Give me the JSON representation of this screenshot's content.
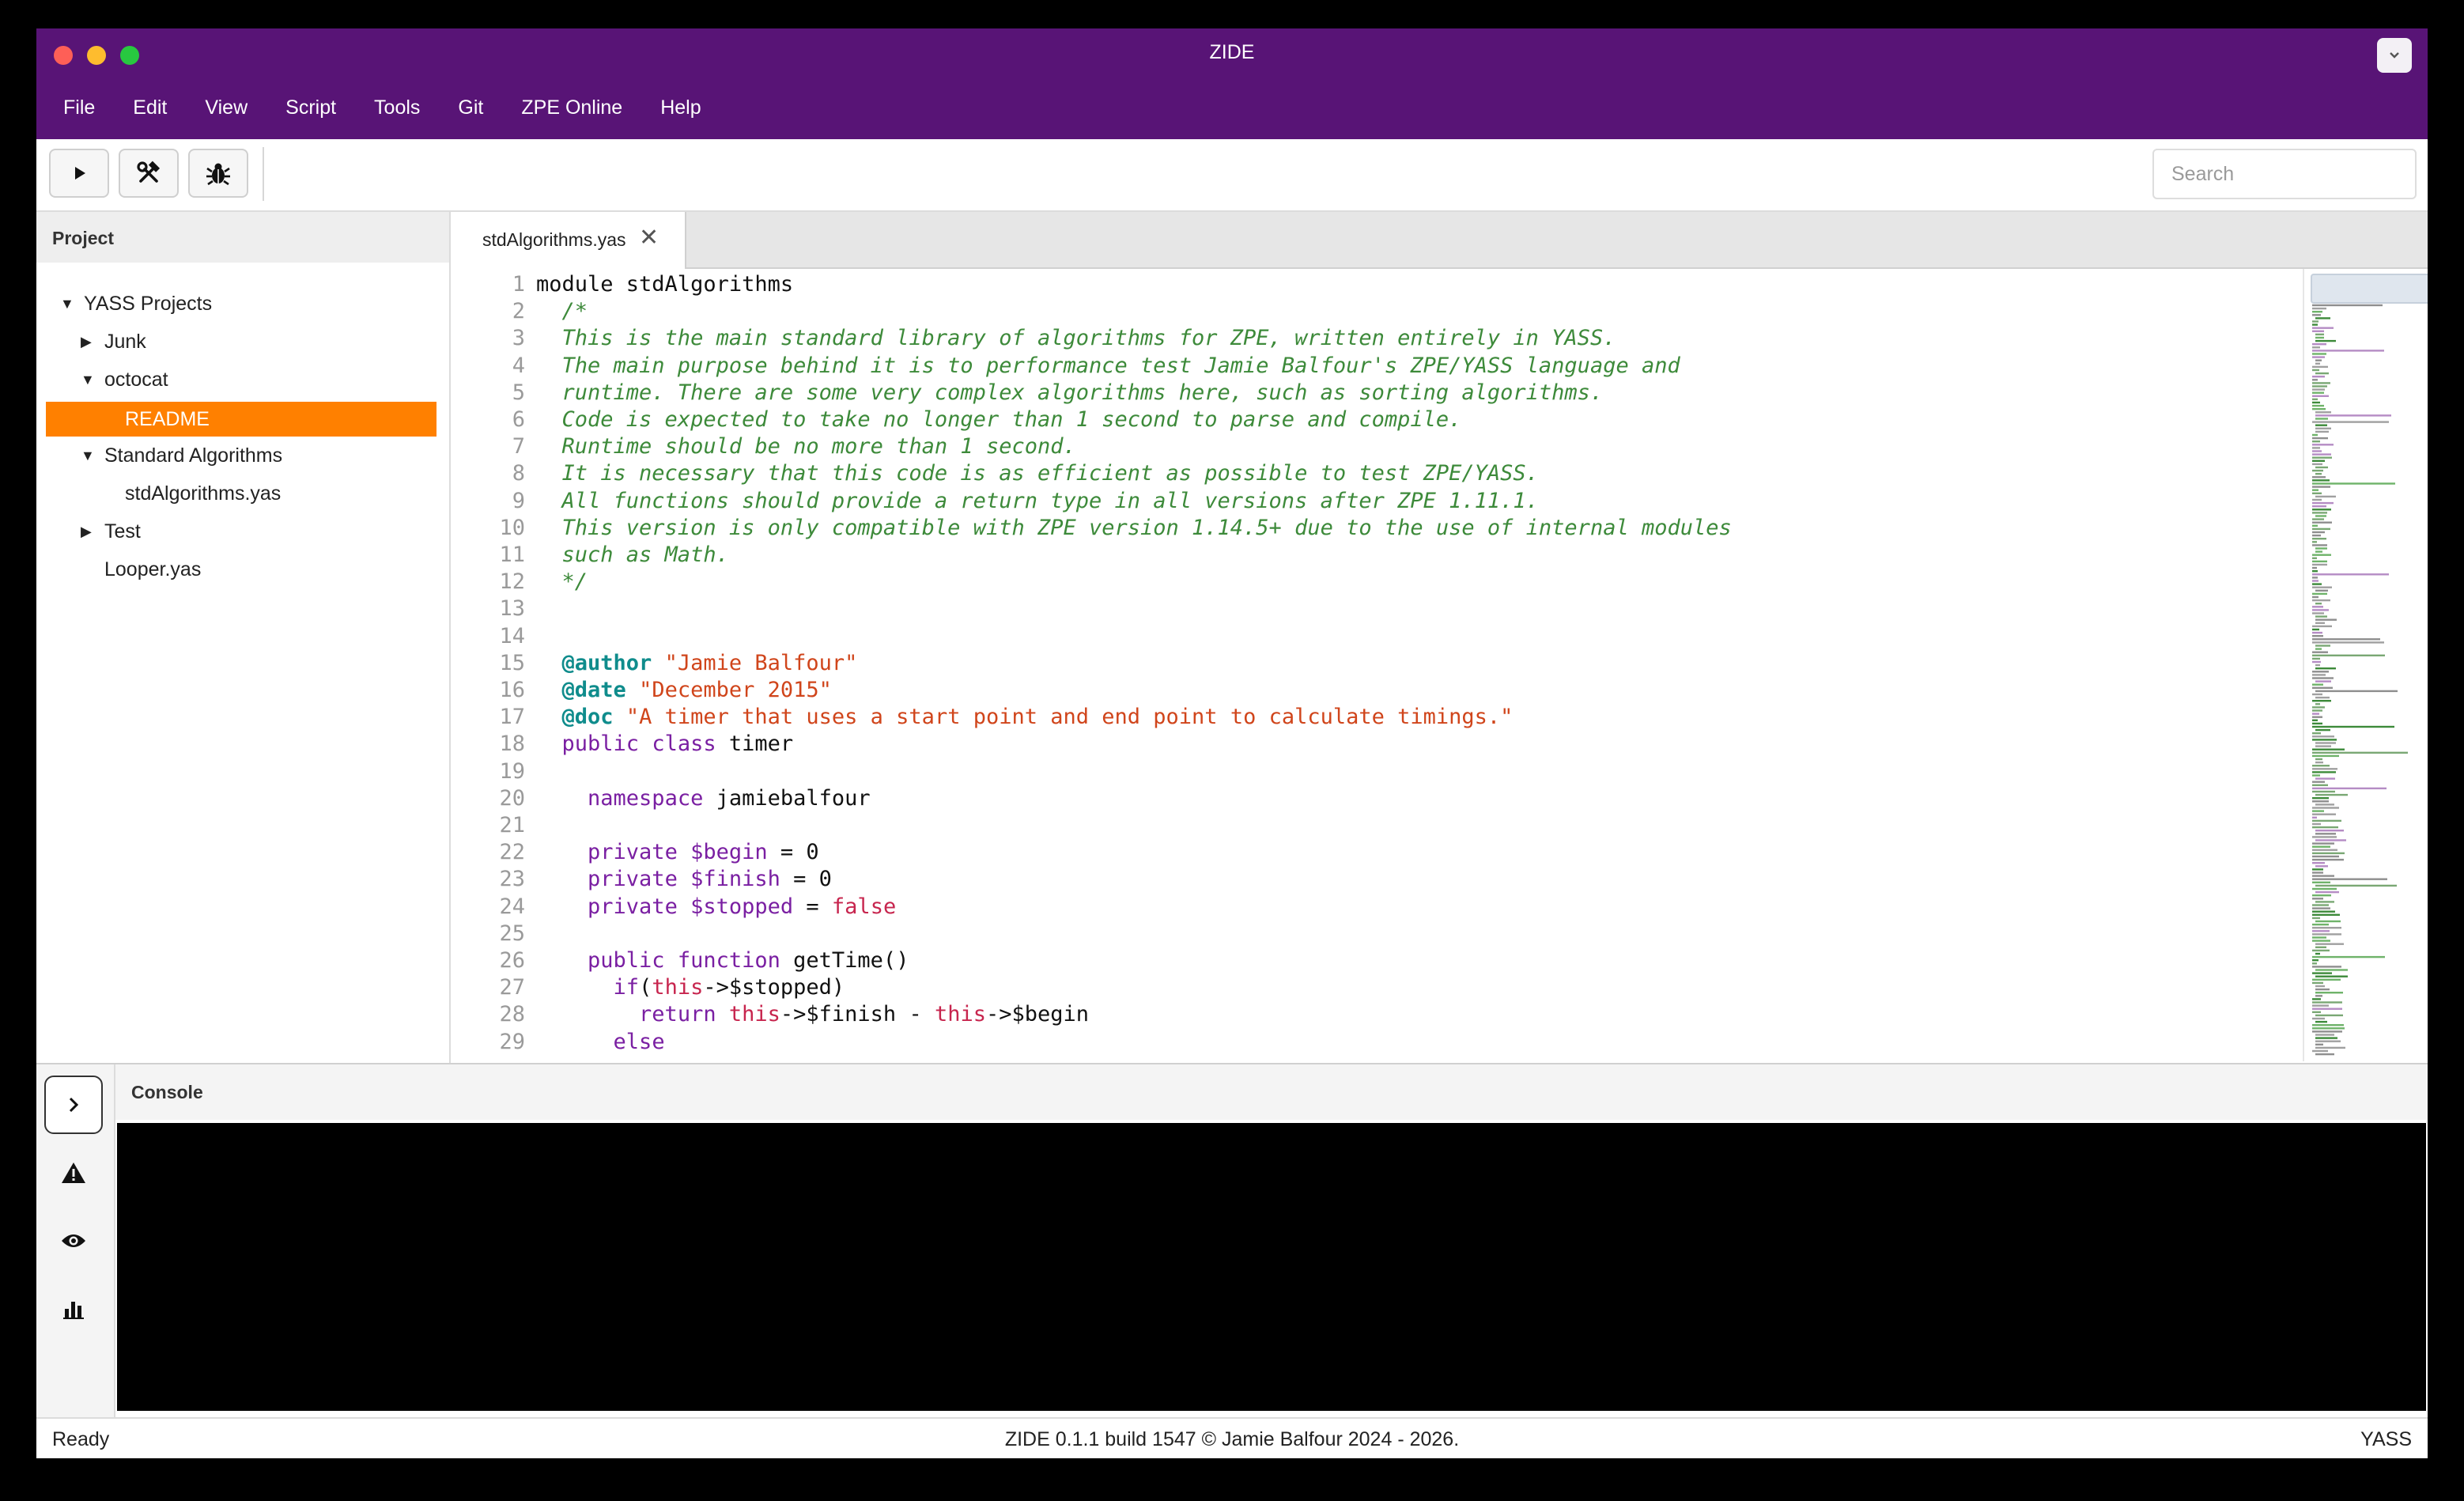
{
  "window": {
    "title": "ZIDE"
  },
  "menu": [
    "File",
    "Edit",
    "View",
    "Script",
    "Tools",
    "Git",
    "ZPE Online",
    "Help"
  ],
  "toolbar": {
    "search_placeholder": "Search"
  },
  "project": {
    "title": "Project",
    "tree": [
      {
        "label": "YASS Projects",
        "level": 0,
        "arrow": "down"
      },
      {
        "label": "Junk",
        "level": 1,
        "arrow": "right"
      },
      {
        "label": "octocat",
        "level": 1,
        "arrow": "down"
      },
      {
        "label": "README",
        "level": 2,
        "arrow": "",
        "selected": true
      },
      {
        "label": "Standard Algorithms",
        "level": 1,
        "arrow": "down"
      },
      {
        "label": "stdAlgorithms.yas",
        "level": 2,
        "arrow": ""
      },
      {
        "label": "Test",
        "level": 1,
        "arrow": "right"
      },
      {
        "label": "Looper.yas",
        "level": 1,
        "arrow": ""
      }
    ]
  },
  "editor": {
    "tab_label": "stdAlgorithms.yas",
    "lines": [
      [
        [
          "t",
          "module stdAlgorithms"
        ]
      ],
      [
        [
          "cm",
          "  /*"
        ]
      ],
      [
        [
          "cm",
          "  This is the main standard library of algorithms for ZPE, written entirely in YASS."
        ]
      ],
      [
        [
          "cm",
          "  The main purpose behind it is to performance test Jamie Balfour's ZPE/YASS language and"
        ]
      ],
      [
        [
          "cm",
          "  runtime. There are some very complex algorithms here, such as sorting algorithms."
        ]
      ],
      [
        [
          "cm",
          "  Code is expected to take no longer than 1 second to parse and compile."
        ]
      ],
      [
        [
          "cm",
          "  Runtime should be no more than 1 second."
        ]
      ],
      [
        [
          "cm",
          "  It is necessary that this code is as efficient as possible to test ZPE/YASS."
        ]
      ],
      [
        [
          "cm",
          "  All functions should provide a return type in all versions after ZPE 1.11.1."
        ]
      ],
      [
        [
          "cm",
          "  This version is only compatible with ZPE version 1.14.5+ due to the use of internal modules"
        ]
      ],
      [
        [
          "cm",
          "  such as Math."
        ]
      ],
      [
        [
          "cm",
          "  */"
        ]
      ],
      [],
      [],
      [
        [
          "t",
          "  "
        ],
        [
          "an",
          "@author"
        ],
        [
          "t",
          " "
        ],
        [
          "st",
          "\"Jamie Balfour\""
        ]
      ],
      [
        [
          "t",
          "  "
        ],
        [
          "an",
          "@date"
        ],
        [
          "t",
          " "
        ],
        [
          "st",
          "\"December 2015\""
        ]
      ],
      [
        [
          "t",
          "  "
        ],
        [
          "an",
          "@doc"
        ],
        [
          "t",
          " "
        ],
        [
          "st",
          "\"A timer that uses a start point and end point to calculate timings.\""
        ]
      ],
      [
        [
          "t",
          "  "
        ],
        [
          "kw",
          "public"
        ],
        [
          "t",
          " "
        ],
        [
          "kw",
          "class"
        ],
        [
          "t",
          " timer"
        ]
      ],
      [],
      [
        [
          "t",
          "    "
        ],
        [
          "kw",
          "namespace"
        ],
        [
          "t",
          " jamiebalfour"
        ]
      ],
      [],
      [
        [
          "t",
          "    "
        ],
        [
          "kw",
          "private"
        ],
        [
          "t",
          " "
        ],
        [
          "kw",
          "$begin"
        ],
        [
          "t",
          " = 0"
        ]
      ],
      [
        [
          "t",
          "    "
        ],
        [
          "kw",
          "private"
        ],
        [
          "t",
          " "
        ],
        [
          "kw",
          "$finish"
        ],
        [
          "t",
          " = 0"
        ]
      ],
      [
        [
          "t",
          "    "
        ],
        [
          "kw",
          "private"
        ],
        [
          "t",
          " "
        ],
        [
          "kw",
          "$stopped"
        ],
        [
          "t",
          " = "
        ],
        [
          "bo",
          "false"
        ]
      ],
      [],
      [
        [
          "t",
          "    "
        ],
        [
          "kw",
          "public"
        ],
        [
          "t",
          " "
        ],
        [
          "kw",
          "function"
        ],
        [
          "t",
          " getTime()"
        ]
      ],
      [
        [
          "t",
          "      "
        ],
        [
          "kw",
          "if"
        ],
        [
          "t",
          "("
        ],
        [
          "bo",
          "this"
        ],
        [
          "t",
          "->$stopped)"
        ]
      ],
      [
        [
          "t",
          "        "
        ],
        [
          "kw",
          "return"
        ],
        [
          "t",
          " "
        ],
        [
          "bo",
          "this"
        ],
        [
          "t",
          "->$finish - "
        ],
        [
          "bo",
          "this"
        ],
        [
          "t",
          "->$begin"
        ]
      ],
      [
        [
          "t",
          "      "
        ],
        [
          "kw",
          "else"
        ]
      ]
    ]
  },
  "console": {
    "title": "Console"
  },
  "status": {
    "left": "Ready",
    "center": "ZIDE 0.1.1 build 1547 © Jamie Balfour 2024 - 2026.",
    "right": "YASS"
  },
  "icons": {
    "run": "play-icon",
    "build": "hammer-wrench-icon",
    "debug": "bug-icon",
    "console_toggle": "chevron-right-icon",
    "warnings": "warning-icon",
    "watch": "eye-icon",
    "stats": "bar-chart-icon"
  },
  "colors": {
    "titlebar": "#581476",
    "selection": "#ff8000",
    "comment": "#3d8a3a",
    "keyword": "#7a1fa2",
    "annotation": "#0f8c8c",
    "string": "#d0451b"
  }
}
